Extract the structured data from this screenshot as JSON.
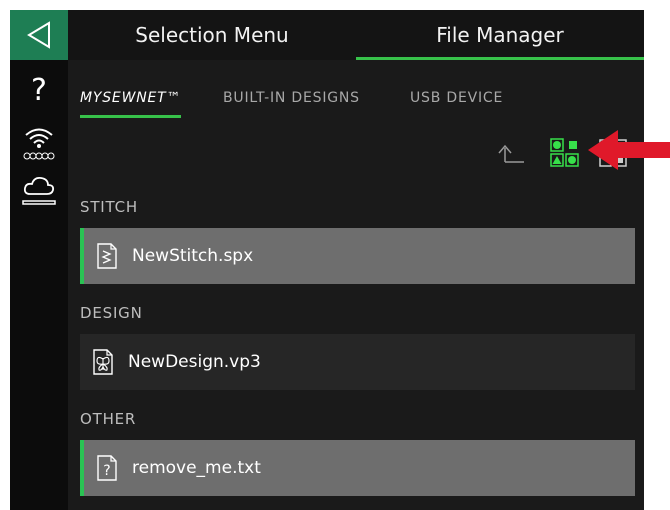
{
  "header": {
    "tabs": [
      {
        "label": "Selection Menu",
        "active": false
      },
      {
        "label": "File Manager",
        "active": true
      }
    ]
  },
  "sidebar": {
    "help_label": "?",
    "icons": [
      "back-arrow-icon",
      "help-icon",
      "wifi-icon",
      "cloud-icon"
    ]
  },
  "subtabs": [
    {
      "label": "MYSEWNET™",
      "active": true
    },
    {
      "label": "BUILT-IN DESIGNS",
      "active": false
    },
    {
      "label": "USB DEVICE",
      "active": false
    }
  ],
  "toolbar": {
    "icons": [
      "up-folder-icon",
      "large-icons-view-icon",
      "list-view-icon"
    ],
    "active_view": "large-icons-view"
  },
  "sections": [
    {
      "label": "STITCH",
      "files": [
        {
          "name": "NewStitch.spx",
          "icon": "stitch-file-icon",
          "selected": true
        }
      ]
    },
    {
      "label": "DESIGN",
      "files": [
        {
          "name": "NewDesign.vp3",
          "icon": "design-file-icon",
          "selected": false
        }
      ]
    },
    {
      "label": "OTHER",
      "files": [
        {
          "name": "remove_me.txt",
          "icon": "unknown-file-icon",
          "selected": true
        }
      ]
    }
  ],
  "colors": {
    "accent": "#37c24a",
    "sidebar_back": "#1e7e54",
    "selected_row": "#6e6e6e",
    "plain_row": "#262626",
    "annotation_arrow": "#e0192a"
  }
}
